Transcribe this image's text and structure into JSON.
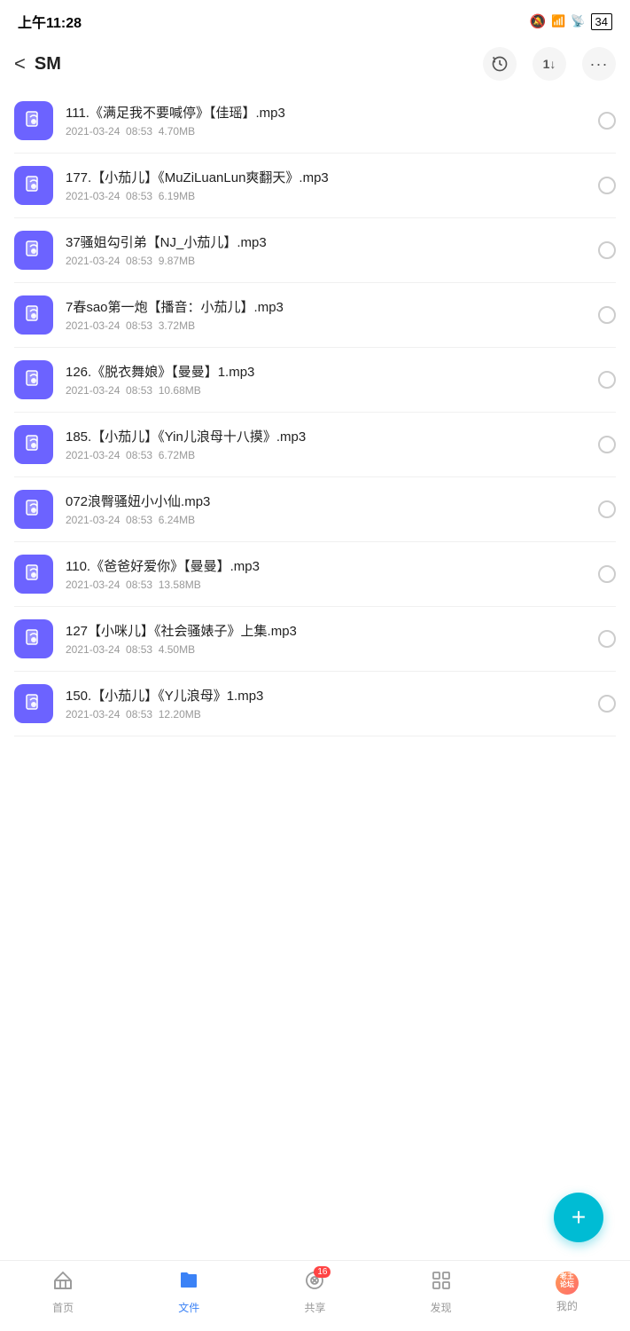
{
  "statusBar": {
    "time": "上午11:28",
    "battery": "34"
  },
  "navBar": {
    "back": "<",
    "title": "SM",
    "historyIcon": "history",
    "sortIcon": "1↓",
    "moreIcon": "..."
  },
  "files": [
    {
      "name": "111.《满足我不要喊停》【佳瑶】.mp3",
      "date": "2021-03-24",
      "time": "08:53",
      "size": "4.70MB"
    },
    {
      "name": "177.【小茄儿】《MuZiLuanLun爽翻天》.mp3",
      "date": "2021-03-24",
      "time": "08:53",
      "size": "6.19MB"
    },
    {
      "name": "37骚姐勾引弟【NJ_小茄儿】.mp3",
      "date": "2021-03-24",
      "time": "08:53",
      "size": "9.87MB"
    },
    {
      "name": "7春sao第一炮【播音：小茄儿】.mp3",
      "date": "2021-03-24",
      "time": "08:53",
      "size": "3.72MB"
    },
    {
      "name": "126.《脱衣舞娘》【曼曼】1.mp3",
      "date": "2021-03-24",
      "time": "08:53",
      "size": "10.68MB"
    },
    {
      "name": "185.【小茄儿】《Yin儿浪母十八摸》.mp3",
      "date": "2021-03-24",
      "time": "08:53",
      "size": "6.72MB"
    },
    {
      "name": "072浪臀骚妞小小仙.mp3",
      "date": "2021-03-24",
      "time": "08:53",
      "size": "6.24MB"
    },
    {
      "name": "110.《爸爸好爱你》【曼曼】.mp3",
      "date": "2021-03-24",
      "time": "08:53",
      "size": "13.58MB"
    },
    {
      "name": "127【小咪儿】《社会骚婊子》上集.mp3",
      "date": "2021-03-24",
      "time": "08:53",
      "size": "4.50MB"
    },
    {
      "name": "150.【小茄儿】《Y儿浪母》1.mp3",
      "date": "2021-03-24",
      "time": "08:53",
      "size": "12.20MB"
    }
  ],
  "fab": {
    "label": "+"
  },
  "bottomNav": [
    {
      "id": "home",
      "label": "首页",
      "active": false
    },
    {
      "id": "files",
      "label": "文件",
      "active": true
    },
    {
      "id": "share",
      "label": "共享",
      "active": false,
      "badge": "16"
    },
    {
      "id": "discover",
      "label": "发现",
      "active": false
    },
    {
      "id": "mine",
      "label": "我的",
      "active": false
    }
  ]
}
